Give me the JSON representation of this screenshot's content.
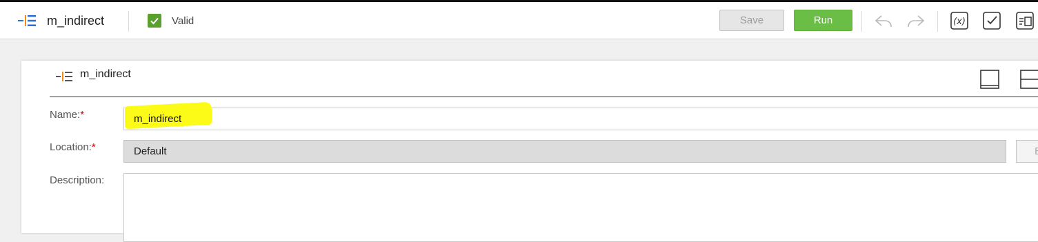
{
  "header": {
    "title": "m_indirect",
    "status": "Valid",
    "save_label": "Save",
    "run_label": "Run",
    "icons": [
      "mapping-icon",
      "valid-check-icon",
      "undo-icon",
      "redo-icon",
      "expression-icon",
      "validate-icon",
      "parameters-icon"
    ]
  },
  "panel": {
    "title": "m_indirect",
    "fields": {
      "name_label": "Name:",
      "name_value": "m_indirect",
      "location_label": "Location:",
      "location_value": "Default",
      "browse_label": "B",
      "description_label": "Description:",
      "description_value": "",
      "required_marker": "*"
    }
  },
  "colors": {
    "accent": "#2b6fd6",
    "run_button": "#6abd45",
    "valid": "#5aa02c",
    "highlight": "#fbfb17",
    "required": "#cc0000"
  }
}
